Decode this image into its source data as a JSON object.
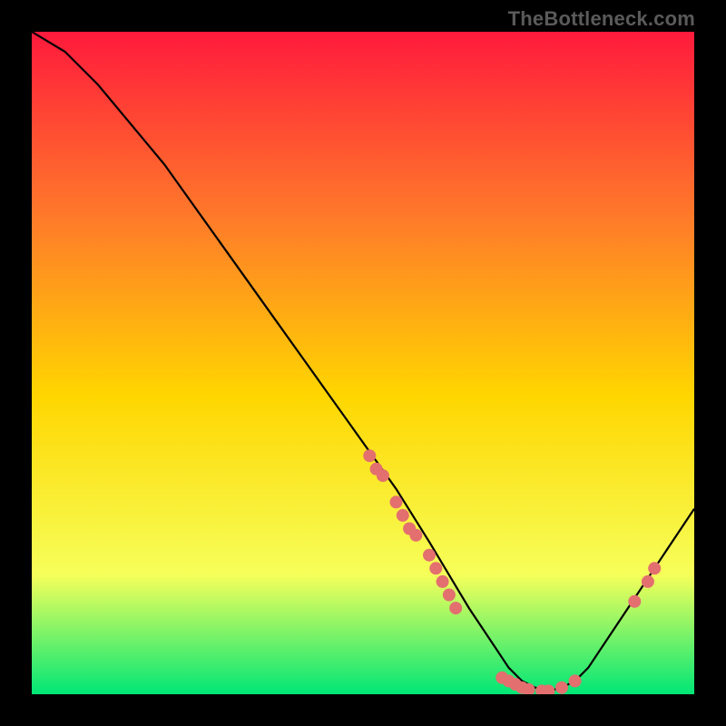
{
  "watermark": "TheBottleneck.com",
  "chart_data": {
    "type": "line",
    "title": "",
    "xlabel": "",
    "ylabel": "",
    "xlim": [
      0,
      100
    ],
    "ylim": [
      0,
      100
    ],
    "grid": false,
    "legend": false,
    "background_gradient": {
      "top": "#ff1a3c",
      "upper_mid": "#ff7a2a",
      "mid": "#ffd600",
      "lower_mid": "#f6ff5a",
      "bottom": "#00e676"
    },
    "series": [
      {
        "name": "bottleneck-curve",
        "color": "#000000",
        "x": [
          0,
          5,
          10,
          15,
          20,
          25,
          30,
          35,
          40,
          45,
          50,
          55,
          60,
          63,
          66,
          68,
          70,
          72,
          74,
          76,
          78,
          80,
          82,
          84,
          86,
          88,
          90,
          92,
          94,
          96,
          98,
          100
        ],
        "y": [
          100,
          97,
          92,
          86,
          80,
          73,
          66,
          59,
          52,
          45,
          38,
          31,
          23,
          18,
          13,
          10,
          7,
          4,
          2,
          1,
          0.5,
          1,
          2,
          4,
          7,
          10,
          13,
          16,
          19,
          22,
          25,
          28
        ]
      }
    ],
    "scatter_points": {
      "name": "highlight-points",
      "color": "#e36f6f",
      "radius": 7,
      "points": [
        {
          "x": 51,
          "y": 36
        },
        {
          "x": 52,
          "y": 34
        },
        {
          "x": 53,
          "y": 33
        },
        {
          "x": 55,
          "y": 29
        },
        {
          "x": 56,
          "y": 27
        },
        {
          "x": 57,
          "y": 25
        },
        {
          "x": 58,
          "y": 24
        },
        {
          "x": 60,
          "y": 21
        },
        {
          "x": 61,
          "y": 19
        },
        {
          "x": 62,
          "y": 17
        },
        {
          "x": 63,
          "y": 15
        },
        {
          "x": 64,
          "y": 13
        },
        {
          "x": 71,
          "y": 2.5
        },
        {
          "x": 72,
          "y": 2
        },
        {
          "x": 73,
          "y": 1.5
        },
        {
          "x": 74,
          "y": 1
        },
        {
          "x": 75,
          "y": 0.7
        },
        {
          "x": 77,
          "y": 0.5
        },
        {
          "x": 78,
          "y": 0.5
        },
        {
          "x": 80,
          "y": 1
        },
        {
          "x": 82,
          "y": 2
        },
        {
          "x": 91,
          "y": 14
        },
        {
          "x": 93,
          "y": 17
        },
        {
          "x": 94,
          "y": 19
        }
      ]
    }
  }
}
